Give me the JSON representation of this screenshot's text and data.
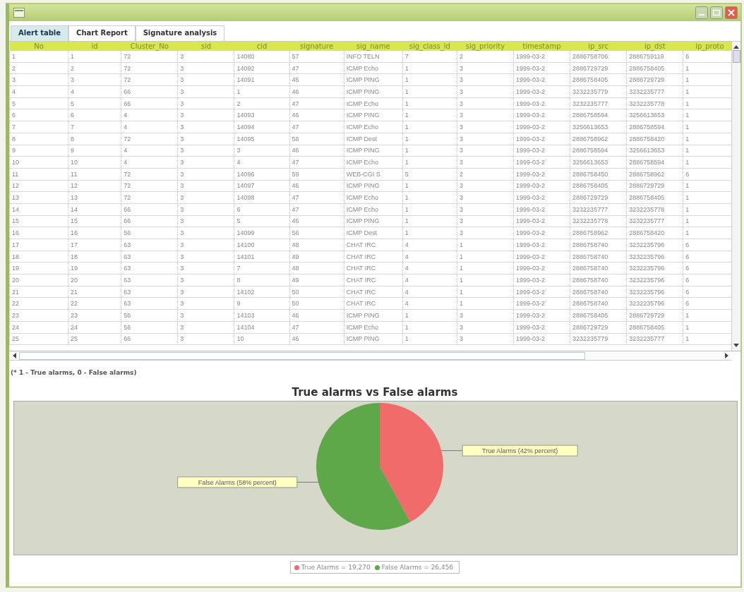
{
  "window": {
    "controls": [
      {
        "kind": "minimize"
      },
      {
        "kind": "maximize"
      },
      {
        "kind": "close"
      }
    ]
  },
  "tabs": [
    {
      "label": "Alert table",
      "selected": true
    },
    {
      "label": "Chart Report",
      "selected": false
    },
    {
      "label": "Signature analysis",
      "selected": false
    }
  ],
  "table": {
    "columns": [
      "No",
      "id",
      "Cluster_No",
      "sid",
      "cid",
      "signature",
      "sig_name",
      "sig_class_id",
      "sig_priority",
      "timestamp",
      "ip_src",
      "ip_dst",
      "ip_proto"
    ],
    "rows": [
      [
        "1",
        "1",
        "72",
        "3",
        "14080",
        "57",
        "INFO TELN",
        "7",
        "2",
        "1999-03-2",
        "2886758706",
        "2886759119",
        "6"
      ],
      [
        "2",
        "2",
        "72",
        "3",
        "14092",
        "47",
        "ICMP Echo",
        "1",
        "3",
        "1999-03-2",
        "2886729729",
        "2886758405",
        "1"
      ],
      [
        "3",
        "3",
        "72",
        "3",
        "14091",
        "46",
        "ICMP PING",
        "1",
        "3",
        "1999-03-2",
        "2886758405",
        "2886729729",
        "1"
      ],
      [
        "4",
        "4",
        "66",
        "3",
        "1",
        "46",
        "ICMP PING",
        "1",
        "3",
        "1999-03-2",
        "3232235779",
        "3232235777",
        "1"
      ],
      [
        "5",
        "5",
        "66",
        "3",
        "2",
        "47",
        "ICMP Echo",
        "1",
        "3",
        "1999-03-2",
        "3232235777",
        "3232235778",
        "1"
      ],
      [
        "6",
        "6",
        "4",
        "3",
        "14093",
        "46",
        "ICMP PING",
        "1",
        "3",
        "1999-03-2",
        "2886758594",
        "3256613653",
        "1"
      ],
      [
        "7",
        "7",
        "4",
        "3",
        "14094",
        "47",
        "ICMP Echo",
        "1",
        "3",
        "1999-03-2",
        "3256613653",
        "2886758594",
        "1"
      ],
      [
        "8",
        "8",
        "72",
        "3",
        "14095",
        "56",
        "ICMP Dest",
        "1",
        "3",
        "1999-03-2",
        "2886758962",
        "2886758420",
        "1"
      ],
      [
        "9",
        "9",
        "4",
        "3",
        "3",
        "46",
        "ICMP PING",
        "1",
        "3",
        "1999-03-2",
        "2886758594",
        "3256613653",
        "1"
      ],
      [
        "10",
        "10",
        "4",
        "3",
        "4",
        "47",
        "ICMP Echo",
        "1",
        "3",
        "1999-03-2",
        "3256613653",
        "2886758594",
        "1"
      ],
      [
        "11",
        "11",
        "72",
        "3",
        "14096",
        "59",
        "WEB-CGI S",
        "5",
        "2",
        "1999-03-2",
        "2886758450",
        "2886758962",
        "6"
      ],
      [
        "12",
        "12",
        "72",
        "3",
        "14097",
        "46",
        "ICMP PING",
        "1",
        "3",
        "1999-03-2",
        "2886758405",
        "2886729729",
        "1"
      ],
      [
        "13",
        "13",
        "72",
        "3",
        "14098",
        "47",
        "ICMP Echo",
        "1",
        "3",
        "1999-03-2",
        "2886729729",
        "2886758405",
        "1"
      ],
      [
        "14",
        "14",
        "66",
        "3",
        "6",
        "47",
        "ICMP Echo",
        "1",
        "3",
        "1999-03-2",
        "3232235777",
        "3232235778",
        "1"
      ],
      [
        "15",
        "15",
        "66",
        "3",
        "5",
        "46",
        "ICMP PING",
        "1",
        "3",
        "1999-03-2",
        "3232235778",
        "3232235777",
        "1"
      ],
      [
        "16",
        "16",
        "56",
        "3",
        "14099",
        "56",
        "ICMP Dest",
        "1",
        "3",
        "1999-03-2",
        "2886758962",
        "2886758420",
        "1"
      ],
      [
        "17",
        "17",
        "63",
        "3",
        "14100",
        "48",
        "CHAT IRC",
        "4",
        "1",
        "1999-03-2",
        "2886758740",
        "3232235796",
        "6"
      ],
      [
        "18",
        "18",
        "63",
        "3",
        "14101",
        "49",
        "CHAT IRC",
        "4",
        "1",
        "1999-03-2",
        "2886758740",
        "3232235796",
        "6"
      ],
      [
        "19",
        "19",
        "63",
        "3",
        "7",
        "48",
        "CHAT IRC",
        "4",
        "1",
        "1999-03-2",
        "2886758740",
        "3232235796",
        "6"
      ],
      [
        "20",
        "20",
        "63",
        "3",
        "8",
        "49",
        "CHAT IRC",
        "4",
        "1",
        "1999-03-2",
        "2886758740",
        "3232235796",
        "6"
      ],
      [
        "21",
        "21",
        "63",
        "3",
        "14102",
        "50",
        "CHAT IRC",
        "4",
        "1",
        "1999-03-2",
        "2886758740",
        "3232235796",
        "6"
      ],
      [
        "22",
        "22",
        "63",
        "3",
        "9",
        "50",
        "CHAT IRC",
        "4",
        "1",
        "1999-03-2",
        "2886758740",
        "3232235796",
        "6"
      ],
      [
        "23",
        "23",
        "56",
        "3",
        "14103",
        "46",
        "ICMP PING",
        "1",
        "3",
        "1999-03-2",
        "2886758405",
        "2886729729",
        "1"
      ],
      [
        "24",
        "24",
        "56",
        "3",
        "14104",
        "47",
        "ICMP Echo",
        "1",
        "3",
        "1999-03-2",
        "2886729729",
        "2886758405",
        "1"
      ],
      [
        "25",
        "25",
        "66",
        "3",
        "10",
        "46",
        "ICMP PING",
        "1",
        "3",
        "1999-03-2",
        "3232235779",
        "3232235777",
        "1"
      ]
    ]
  },
  "note": "(* 1 - True alarms, 0 - False alarms)",
  "chart": {
    "chart_data": {
      "type": "pie",
      "title": "True alarms vs False alarms",
      "categories": [
        "True Alarms (42% percent)",
        "False Alarms (58% percent)"
      ],
      "values": [
        42,
        58
      ]
    },
    "legend": [
      {
        "label": "True Alarms = 19,270",
        "color": "#f26b6b"
      },
      {
        "label": "False Alarms = 26,456",
        "color": "#5fa84a"
      }
    ]
  }
}
